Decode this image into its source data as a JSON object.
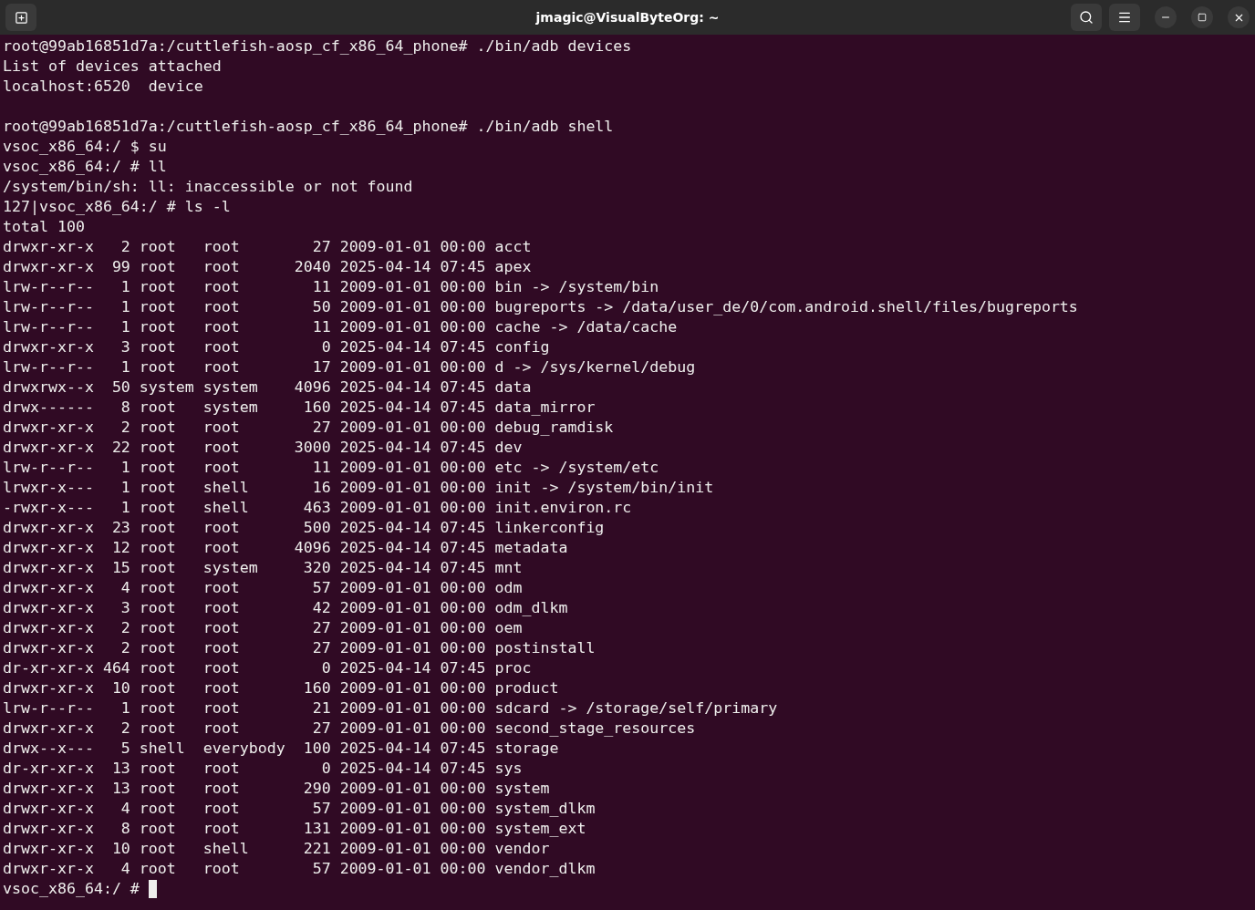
{
  "window": {
    "title": "jmagic@VisualByteOrg: ~"
  },
  "terminal": {
    "blocks": [
      {
        "lines": [
          "root@99ab16851d7a:/cuttlefish-aosp_cf_x86_64_phone# ./bin/adb devices",
          "List of devices attached",
          "localhost:6520  device"
        ]
      },
      {
        "lines": [
          "root@99ab16851d7a:/cuttlefish-aosp_cf_x86_64_phone# ./bin/adb shell",
          "vsoc_x86_64:/ $ su",
          "vsoc_x86_64:/ # ll",
          "/system/bin/sh: ll: inaccessible or not found",
          "127|vsoc_x86_64:/ # ls -l",
          "total 100",
          "drwxr-xr-x   2 root   root        27 2009-01-01 00:00 acct",
          "drwxr-xr-x  99 root   root      2040 2025-04-14 07:45 apex",
          "lrw-r--r--   1 root   root        11 2009-01-01 00:00 bin -> /system/bin",
          "lrw-r--r--   1 root   root        50 2009-01-01 00:00 bugreports -> /data/user_de/0/com.android.shell/files/bugreports",
          "lrw-r--r--   1 root   root        11 2009-01-01 00:00 cache -> /data/cache",
          "drwxr-xr-x   3 root   root         0 2025-04-14 07:45 config",
          "lrw-r--r--   1 root   root        17 2009-01-01 00:00 d -> /sys/kernel/debug",
          "drwxrwx--x  50 system system    4096 2025-04-14 07:45 data",
          "drwx------   8 root   system     160 2025-04-14 07:45 data_mirror",
          "drwxr-xr-x   2 root   root        27 2009-01-01 00:00 debug_ramdisk",
          "drwxr-xr-x  22 root   root      3000 2025-04-14 07:45 dev",
          "lrw-r--r--   1 root   root        11 2009-01-01 00:00 etc -> /system/etc",
          "lrwxr-x---   1 root   shell       16 2009-01-01 00:00 init -> /system/bin/init",
          "-rwxr-x---   1 root   shell      463 2009-01-01 00:00 init.environ.rc",
          "drwxr-xr-x  23 root   root       500 2025-04-14 07:45 linkerconfig",
          "drwxr-xr-x  12 root   root      4096 2025-04-14 07:45 metadata",
          "drwxr-xr-x  15 root   system     320 2025-04-14 07:45 mnt",
          "drwxr-xr-x   4 root   root        57 2009-01-01 00:00 odm",
          "drwxr-xr-x   3 root   root        42 2009-01-01 00:00 odm_dlkm",
          "drwxr-xr-x   2 root   root        27 2009-01-01 00:00 oem",
          "drwxr-xr-x   2 root   root        27 2009-01-01 00:00 postinstall",
          "dr-xr-xr-x 464 root   root         0 2025-04-14 07:45 proc",
          "drwxr-xr-x  10 root   root       160 2009-01-01 00:00 product",
          "lrw-r--r--   1 root   root        21 2009-01-01 00:00 sdcard -> /storage/self/primary",
          "drwxr-xr-x   2 root   root        27 2009-01-01 00:00 second_stage_resources",
          "drwx--x---   5 shell  everybody  100 2025-04-14 07:45 storage",
          "dr-xr-xr-x  13 root   root         0 2025-04-14 07:45 sys",
          "drwxr-xr-x  13 root   root       290 2009-01-01 00:00 system",
          "drwxr-xr-x   4 root   root        57 2009-01-01 00:00 system_dlkm",
          "drwxr-xr-x   8 root   root       131 2009-01-01 00:00 system_ext",
          "drwxr-xr-x  10 root   shell      221 2009-01-01 00:00 vendor",
          "drwxr-xr-x   4 root   root        57 2009-01-01 00:00 vendor_dlkm"
        ]
      }
    ],
    "prompt": {
      "text": "vsoc_x86_64:/ # ",
      "cursor": true
    }
  }
}
